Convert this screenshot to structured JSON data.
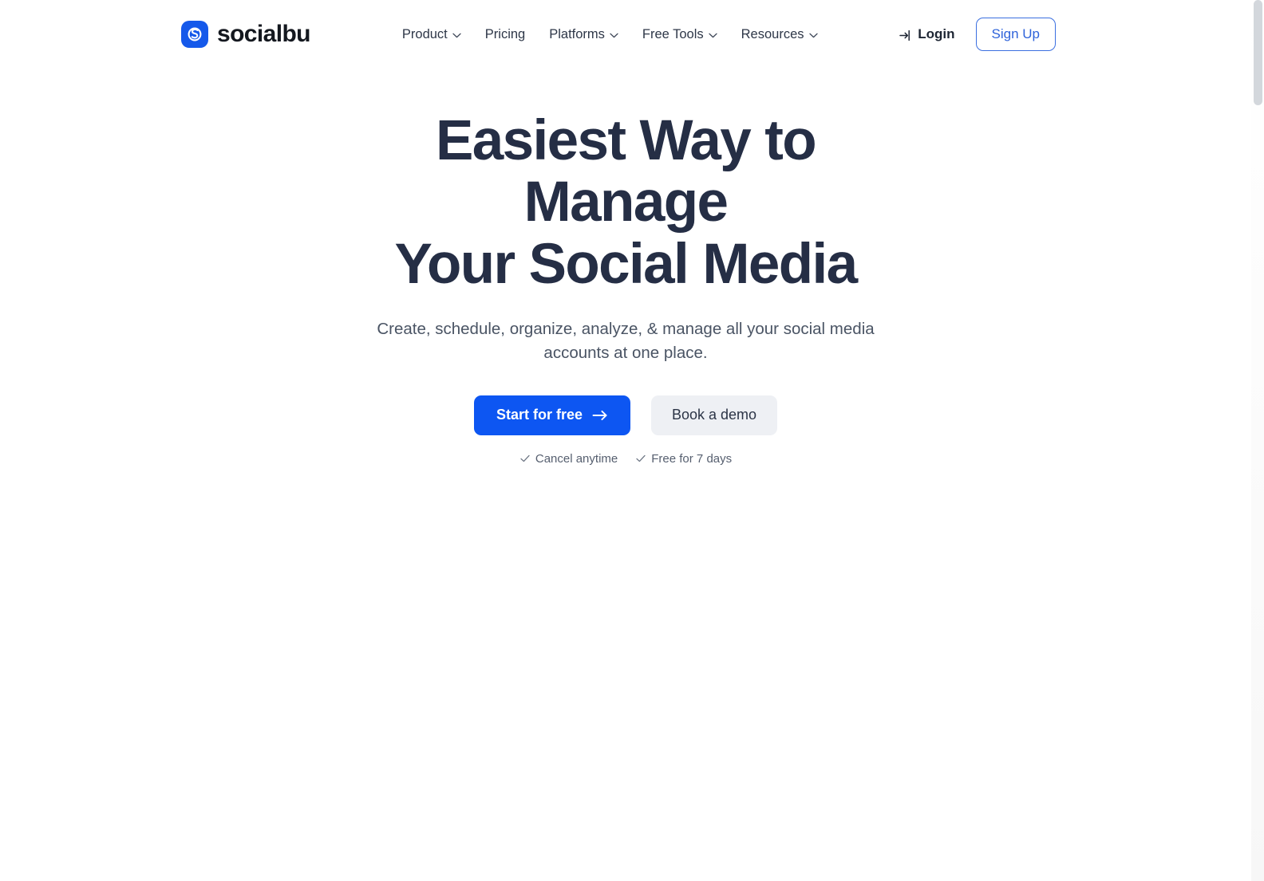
{
  "brand": {
    "name": "socialbu",
    "mark_icon": "socialbu-logo-icon",
    "mark_color": "#1559ea"
  },
  "nav": {
    "items": [
      {
        "label": "Product",
        "has_dropdown": true,
        "icon": "chevron-down-icon"
      },
      {
        "label": "Pricing",
        "has_dropdown": false,
        "icon": ""
      },
      {
        "label": "Platforms",
        "has_dropdown": true,
        "icon": "chevron-down-icon"
      },
      {
        "label": "Free Tools",
        "has_dropdown": true,
        "icon": "chevron-down-icon"
      },
      {
        "label": "Resources",
        "has_dropdown": true,
        "icon": "chevron-down-icon"
      }
    ],
    "login": {
      "label": "Login",
      "icon": "login-arrow-icon"
    },
    "signup": {
      "label": "Sign Up",
      "border_color": "#3b6fe0",
      "text_color": "#2f63da"
    }
  },
  "hero": {
    "title_line1": "Easiest Way to Manage",
    "title_line2": "Your Social Media",
    "subtitle": "Create, schedule, organize, analyze, & manage all your social media accounts at one place.",
    "primary_cta": {
      "label": "Start for free",
      "icon": "arrow-right-icon",
      "bg_color": "#0d56f2",
      "text_color": "#ffffff"
    },
    "secondary_cta": {
      "label": "Book a demo",
      "bg_color": "#eef0f4",
      "text_color": "#2b3446"
    },
    "notes": [
      {
        "label": "Cancel anytime",
        "icon": "check-icon"
      },
      {
        "label": "Free for 7 days",
        "icon": "check-icon"
      }
    ]
  },
  "scrollbar": {
    "thumb_color": "#d3d7dc",
    "track_color": "#fafafa"
  }
}
